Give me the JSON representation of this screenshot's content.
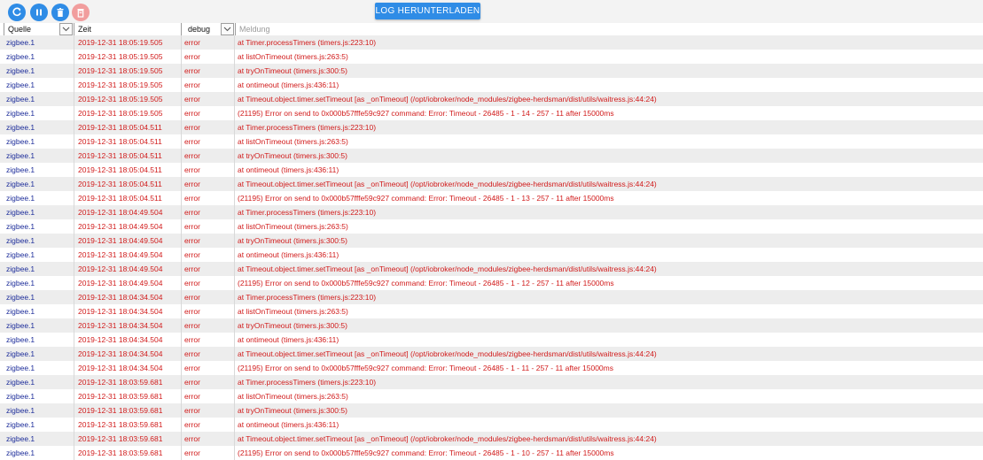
{
  "toolbar": {
    "buttons": [
      {
        "name": "refresh-button",
        "icon": "refresh-icon"
      },
      {
        "name": "pause-button",
        "icon": "pause-icon"
      },
      {
        "name": "clear-log-button",
        "icon": "trash-icon"
      },
      {
        "name": "delete-log-button",
        "icon": "trash-icon"
      }
    ],
    "download_label": "LOG HERUNTERLADEN"
  },
  "filters": {
    "source": "Quelle",
    "time": "Zeit",
    "level": "debug",
    "message_placeholder": "Meldung"
  },
  "colors": {
    "accent": "#2f8ce6",
    "error_text": "#d11b1b",
    "source_text": "#1d2d9a",
    "stripe": "#ededed"
  },
  "rows": [
    {
      "source": "zigbee.1",
      "time": "2019-12-31 18:05:19.505",
      "severity": "error",
      "message": "at Timer.processTimers (timers.js:223:10)"
    },
    {
      "source": "zigbee.1",
      "time": "2019-12-31 18:05:19.505",
      "severity": "error",
      "message": "at listOnTimeout (timers.js:263:5)"
    },
    {
      "source": "zigbee.1",
      "time": "2019-12-31 18:05:19.505",
      "severity": "error",
      "message": "at tryOnTimeout (timers.js:300:5)"
    },
    {
      "source": "zigbee.1",
      "time": "2019-12-31 18:05:19.505",
      "severity": "error",
      "message": "at ontimeout (timers.js:436:11)"
    },
    {
      "source": "zigbee.1",
      "time": "2019-12-31 18:05:19.505",
      "severity": "error",
      "message": "at Timeout.object.timer.setTimeout [as _onTimeout] (/opt/iobroker/node_modules/zigbee-herdsman/dist/utils/waitress.js:44:24)"
    },
    {
      "source": "zigbee.1",
      "time": "2019-12-31 18:05:19.505",
      "severity": "error",
      "message": "(21195) Error on send to 0x000b57fffe59c927 command: Error: Timeout - 26485 - 1 - 14 - 257 - 11 after 15000ms"
    },
    {
      "source": "zigbee.1",
      "time": "2019-12-31 18:05:04.511",
      "severity": "error",
      "message": "at Timer.processTimers (timers.js:223:10)"
    },
    {
      "source": "zigbee.1",
      "time": "2019-12-31 18:05:04.511",
      "severity": "error",
      "message": "at listOnTimeout (timers.js:263:5)"
    },
    {
      "source": "zigbee.1",
      "time": "2019-12-31 18:05:04.511",
      "severity": "error",
      "message": "at tryOnTimeout (timers.js:300:5)"
    },
    {
      "source": "zigbee.1",
      "time": "2019-12-31 18:05:04.511",
      "severity": "error",
      "message": "at ontimeout (timers.js:436:11)"
    },
    {
      "source": "zigbee.1",
      "time": "2019-12-31 18:05:04.511",
      "severity": "error",
      "message": "at Timeout.object.timer.setTimeout [as _onTimeout] (/opt/iobroker/node_modules/zigbee-herdsman/dist/utils/waitress.js:44:24)"
    },
    {
      "source": "zigbee.1",
      "time": "2019-12-31 18:05:04.511",
      "severity": "error",
      "message": "(21195) Error on send to 0x000b57fffe59c927 command: Error: Timeout - 26485 - 1 - 13 - 257 - 11 after 15000ms"
    },
    {
      "source": "zigbee.1",
      "time": "2019-12-31 18:04:49.504",
      "severity": "error",
      "message": "at Timer.processTimers (timers.js:223:10)"
    },
    {
      "source": "zigbee.1",
      "time": "2019-12-31 18:04:49.504",
      "severity": "error",
      "message": "at listOnTimeout (timers.js:263:5)"
    },
    {
      "source": "zigbee.1",
      "time": "2019-12-31 18:04:49.504",
      "severity": "error",
      "message": "at tryOnTimeout (timers.js:300:5)"
    },
    {
      "source": "zigbee.1",
      "time": "2019-12-31 18:04:49.504",
      "severity": "error",
      "message": "at ontimeout (timers.js:436:11)"
    },
    {
      "source": "zigbee.1",
      "time": "2019-12-31 18:04:49.504",
      "severity": "error",
      "message": "at Timeout.object.timer.setTimeout [as _onTimeout] (/opt/iobroker/node_modules/zigbee-herdsman/dist/utils/waitress.js:44:24)"
    },
    {
      "source": "zigbee.1",
      "time": "2019-12-31 18:04:49.504",
      "severity": "error",
      "message": "(21195) Error on send to 0x000b57fffe59c927 command: Error: Timeout - 26485 - 1 - 12 - 257 - 11 after 15000ms"
    },
    {
      "source": "zigbee.1",
      "time": "2019-12-31 18:04:34.504",
      "severity": "error",
      "message": "at Timer.processTimers (timers.js:223:10)"
    },
    {
      "source": "zigbee.1",
      "time": "2019-12-31 18:04:34.504",
      "severity": "error",
      "message": "at listOnTimeout (timers.js:263:5)"
    },
    {
      "source": "zigbee.1",
      "time": "2019-12-31 18:04:34.504",
      "severity": "error",
      "message": "at tryOnTimeout (timers.js:300:5)"
    },
    {
      "source": "zigbee.1",
      "time": "2019-12-31 18:04:34.504",
      "severity": "error",
      "message": "at ontimeout (timers.js:436:11)"
    },
    {
      "source": "zigbee.1",
      "time": "2019-12-31 18:04:34.504",
      "severity": "error",
      "message": "at Timeout.object.timer.setTimeout [as _onTimeout] (/opt/iobroker/node_modules/zigbee-herdsman/dist/utils/waitress.js:44:24)"
    },
    {
      "source": "zigbee.1",
      "time": "2019-12-31 18:04:34.504",
      "severity": "error",
      "message": "(21195) Error on send to 0x000b57fffe59c927 command: Error: Timeout - 26485 - 1 - 11 - 257 - 11 after 15000ms"
    },
    {
      "source": "zigbee.1",
      "time": "2019-12-31 18:03:59.681",
      "severity": "error",
      "message": "at Timer.processTimers (timers.js:223:10)"
    },
    {
      "source": "zigbee.1",
      "time": "2019-12-31 18:03:59.681",
      "severity": "error",
      "message": "at listOnTimeout (timers.js:263:5)"
    },
    {
      "source": "zigbee.1",
      "time": "2019-12-31 18:03:59.681",
      "severity": "error",
      "message": "at tryOnTimeout (timers.js:300:5)"
    },
    {
      "source": "zigbee.1",
      "time": "2019-12-31 18:03:59.681",
      "severity": "error",
      "message": "at ontimeout (timers.js:436:11)"
    },
    {
      "source": "zigbee.1",
      "time": "2019-12-31 18:03:59.681",
      "severity": "error",
      "message": "at Timeout.object.timer.setTimeout [as _onTimeout] (/opt/iobroker/node_modules/zigbee-herdsman/dist/utils/waitress.js:44:24)"
    },
    {
      "source": "zigbee.1",
      "time": "2019-12-31 18:03:59.681",
      "severity": "error",
      "message": "(21195) Error on send to 0x000b57fffe59c927 command: Error: Timeout - 26485 - 1 - 10 - 257 - 11 after 15000ms"
    }
  ]
}
